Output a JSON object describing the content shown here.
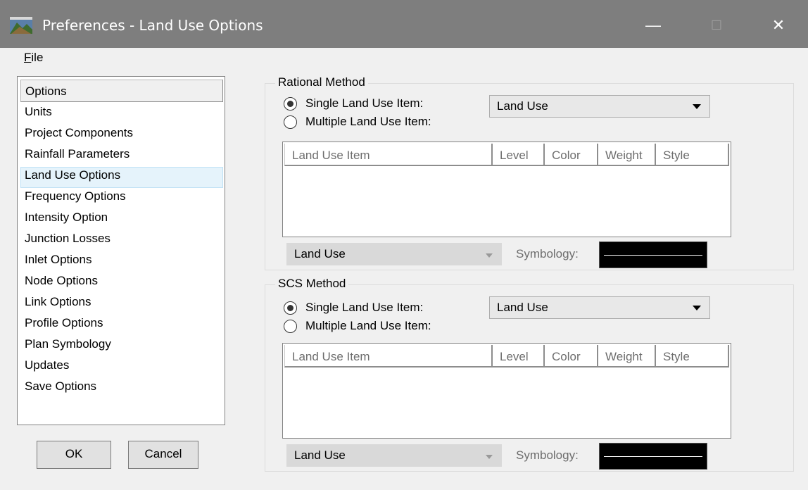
{
  "window": {
    "title": "Preferences - Land Use Options",
    "min_glyph": "—",
    "max_glyph": "☐",
    "close_glyph": "✕"
  },
  "menu": {
    "file": "File"
  },
  "options": {
    "header": "Options",
    "items": [
      "Units",
      "Project Components",
      "Rainfall Parameters",
      "Land Use Options",
      "Frequency Options",
      "Intensity Option",
      "Junction Losses",
      "Inlet Options",
      "Node Options",
      "Link Options",
      "Profile Options",
      "Plan Symbology",
      "Updates",
      "Save Options"
    ],
    "selected": "Land Use Options"
  },
  "buttons": {
    "ok": "OK",
    "cancel": "Cancel"
  },
  "rational": {
    "title": "Rational Method",
    "single_label": "Single Land Use Item:",
    "multiple_label": "Multiple Land Use Item:",
    "single_checked": true,
    "single_combo_value": "Land Use",
    "columns": [
      "Land Use Item",
      "Level",
      "Color",
      "Weight",
      "Style"
    ],
    "bottom_combo_value": "Land Use",
    "symbology_label": "Symbology:"
  },
  "scs": {
    "title": "SCS Method",
    "single_label": "Single Land Use Item:",
    "multiple_label": "Multiple Land Use Item:",
    "single_checked": true,
    "single_combo_value": "Land Use",
    "columns": [
      "Land Use Item",
      "Level",
      "Color",
      "Weight",
      "Style"
    ],
    "bottom_combo_value": "Land Use",
    "symbology_label": "Symbology:"
  },
  "colors": {
    "titlebar": "#7e7e7e",
    "selection": "#e5f3fb",
    "symbology_swatch": "#000000"
  }
}
